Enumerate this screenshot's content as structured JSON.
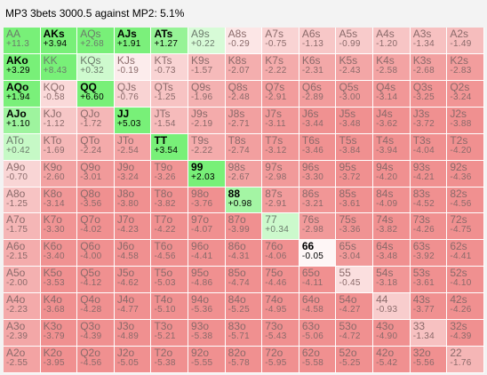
{
  "title": "MP3 3bets 3000.5 against MP2: 5.1%",
  "colors": {
    "strong_green": "#78f078",
    "neutral": "#ffffff",
    "strong_red": "#f09090"
  },
  "rows": [
    [
      {
        "hand": "AA",
        "val": "+11.3",
        "v": 11.3,
        "hl": false
      },
      {
        "hand": "AKs",
        "val": "+3.94",
        "v": 3.94,
        "hl": true
      },
      {
        "hand": "AQs",
        "val": "+2.68",
        "v": 2.68,
        "hl": false
      },
      {
        "hand": "AJs",
        "val": "+1.91",
        "v": 1.91,
        "hl": true
      },
      {
        "hand": "ATs",
        "val": "+1.27",
        "v": 1.27,
        "hl": true
      },
      {
        "hand": "A9s",
        "val": "+0.22",
        "v": 0.22,
        "hl": false
      },
      {
        "hand": "A8s",
        "val": "-0.29",
        "v": -0.29,
        "hl": false
      },
      {
        "hand": "A7s",
        "val": "-0.75",
        "v": -0.75,
        "hl": false
      },
      {
        "hand": "A6s",
        "val": "-1.13",
        "v": -1.13,
        "hl": false
      },
      {
        "hand": "A5s",
        "val": "-0.99",
        "v": -0.99,
        "hl": false
      },
      {
        "hand": "A4s",
        "val": "-1.20",
        "v": -1.2,
        "hl": false
      },
      {
        "hand": "A3s",
        "val": "-1.34",
        "v": -1.34,
        "hl": false
      },
      {
        "hand": "A2s",
        "val": "-1.49",
        "v": -1.49,
        "hl": false
      }
    ],
    [
      {
        "hand": "AKo",
        "val": "+3.29",
        "v": 3.29,
        "hl": true
      },
      {
        "hand": "KK",
        "val": "+8.43",
        "v": 8.43,
        "hl": false
      },
      {
        "hand": "KQs",
        "val": "+0.32",
        "v": 0.32,
        "hl": false
      },
      {
        "hand": "KJs",
        "val": "-0.19",
        "v": -0.19,
        "hl": false
      },
      {
        "hand": "KTs",
        "val": "-0.73",
        "v": -0.73,
        "hl": false
      },
      {
        "hand": "K9s",
        "val": "-1.57",
        "v": -1.57,
        "hl": false
      },
      {
        "hand": "K8s",
        "val": "-2.07",
        "v": -2.07,
        "hl": false
      },
      {
        "hand": "K7s",
        "val": "-2.22",
        "v": -2.22,
        "hl": false
      },
      {
        "hand": "K6s",
        "val": "-2.31",
        "v": -2.31,
        "hl": false
      },
      {
        "hand": "K5s",
        "val": "-2.43",
        "v": -2.43,
        "hl": false
      },
      {
        "hand": "K4s",
        "val": "-2.58",
        "v": -2.58,
        "hl": false
      },
      {
        "hand": "K3s",
        "val": "-2.68",
        "v": -2.68,
        "hl": false
      },
      {
        "hand": "K2s",
        "val": "-2.83",
        "v": -2.83,
        "hl": false
      }
    ],
    [
      {
        "hand": "AQo",
        "val": "+1.94",
        "v": 1.94,
        "hl": true
      },
      {
        "hand": "KQo",
        "val": "-0.58",
        "v": -0.58,
        "hl": false
      },
      {
        "hand": "QQ",
        "val": "+6.60",
        "v": 6.6,
        "hl": true
      },
      {
        "hand": "QJs",
        "val": "-0.76",
        "v": -0.76,
        "hl": false
      },
      {
        "hand": "QTs",
        "val": "-1.25",
        "v": -1.25,
        "hl": false
      },
      {
        "hand": "Q9s",
        "val": "-1.96",
        "v": -1.96,
        "hl": false
      },
      {
        "hand": "Q8s",
        "val": "-2.48",
        "v": -2.48,
        "hl": false
      },
      {
        "hand": "Q7s",
        "val": "-2.91",
        "v": -2.91,
        "hl": false
      },
      {
        "hand": "Q6s",
        "val": "-2.89",
        "v": -2.89,
        "hl": false
      },
      {
        "hand": "Q5s",
        "val": "-3.00",
        "v": -3.0,
        "hl": false
      },
      {
        "hand": "Q4s",
        "val": "-3.14",
        "v": -3.14,
        "hl": false
      },
      {
        "hand": "Q3s",
        "val": "-3.25",
        "v": -3.25,
        "hl": false
      },
      {
        "hand": "Q2s",
        "val": "-3.24",
        "v": -3.24,
        "hl": false
      }
    ],
    [
      {
        "hand": "AJo",
        "val": "+1.10",
        "v": 1.1,
        "hl": true
      },
      {
        "hand": "KJo",
        "val": "-1.12",
        "v": -1.12,
        "hl": false
      },
      {
        "hand": "QJo",
        "val": "-1.72",
        "v": -1.72,
        "hl": false
      },
      {
        "hand": "JJ",
        "val": "+5.03",
        "v": 5.03,
        "hl": true
      },
      {
        "hand": "JTs",
        "val": "-1.54",
        "v": -1.54,
        "hl": false
      },
      {
        "hand": "J9s",
        "val": "-2.19",
        "v": -2.19,
        "hl": false
      },
      {
        "hand": "J8s",
        "val": "-2.71",
        "v": -2.71,
        "hl": false
      },
      {
        "hand": "J7s",
        "val": "-3.11",
        "v": -3.11,
        "hl": false
      },
      {
        "hand": "J6s",
        "val": "-3.44",
        "v": -3.44,
        "hl": false
      },
      {
        "hand": "J5s",
        "val": "-3.48",
        "v": -3.48,
        "hl": false
      },
      {
        "hand": "J4s",
        "val": "-3.62",
        "v": -3.62,
        "hl": false
      },
      {
        "hand": "J3s",
        "val": "-3.72",
        "v": -3.72,
        "hl": false
      },
      {
        "hand": "J2s",
        "val": "-3.88",
        "v": -3.88,
        "hl": false
      }
    ],
    [
      {
        "hand": "ATo",
        "val": "+0.42",
        "v": 0.42,
        "hl": false
      },
      {
        "hand": "KTo",
        "val": "-1.69",
        "v": -1.69,
        "hl": false
      },
      {
        "hand": "QTo",
        "val": "-2.24",
        "v": -2.24,
        "hl": false
      },
      {
        "hand": "JTo",
        "val": "-2.54",
        "v": -2.54,
        "hl": false
      },
      {
        "hand": "TT",
        "val": "+3.54",
        "v": 3.54,
        "hl": true
      },
      {
        "hand": "T9s",
        "val": "-2.22",
        "v": -2.22,
        "hl": false
      },
      {
        "hand": "T8s",
        "val": "-2.74",
        "v": -2.74,
        "hl": false
      },
      {
        "hand": "T7s",
        "val": "-3.12",
        "v": -3.12,
        "hl": false
      },
      {
        "hand": "T6s",
        "val": "-3.46",
        "v": -3.46,
        "hl": false
      },
      {
        "hand": "T5s",
        "val": "-3.84",
        "v": -3.84,
        "hl": false
      },
      {
        "hand": "T4s",
        "val": "-3.94",
        "v": -3.94,
        "hl": false
      },
      {
        "hand": "T3s",
        "val": "-4.04",
        "v": -4.04,
        "hl": false
      },
      {
        "hand": "T2s",
        "val": "-4.20",
        "v": -4.2,
        "hl": false
      }
    ],
    [
      {
        "hand": "A9o",
        "val": "-0.70",
        "v": -0.7,
        "hl": false
      },
      {
        "hand": "K9o",
        "val": "-2.60",
        "v": -2.6,
        "hl": false
      },
      {
        "hand": "Q9o",
        "val": "-3.01",
        "v": -3.01,
        "hl": false
      },
      {
        "hand": "J9o",
        "val": "-3.24",
        "v": -3.24,
        "hl": false
      },
      {
        "hand": "T9o",
        "val": "-3.26",
        "v": -3.26,
        "hl": false
      },
      {
        "hand": "99",
        "val": "+2.03",
        "v": 2.03,
        "hl": true
      },
      {
        "hand": "98s",
        "val": "-2.67",
        "v": -2.67,
        "hl": false
      },
      {
        "hand": "97s",
        "val": "-2.98",
        "v": -2.98,
        "hl": false
      },
      {
        "hand": "96s",
        "val": "-3.30",
        "v": -3.3,
        "hl": false
      },
      {
        "hand": "95s",
        "val": "-3.72",
        "v": -3.72,
        "hl": false
      },
      {
        "hand": "94s",
        "val": "-4.20",
        "v": -4.2,
        "hl": false
      },
      {
        "hand": "93s",
        "val": "-4.21",
        "v": -4.21,
        "hl": false
      },
      {
        "hand": "92s",
        "val": "-4.36",
        "v": -4.36,
        "hl": false
      }
    ],
    [
      {
        "hand": "A8o",
        "val": "-1.25",
        "v": -1.25,
        "hl": false
      },
      {
        "hand": "K8o",
        "val": "-3.14",
        "v": -3.14,
        "hl": false
      },
      {
        "hand": "Q8o",
        "val": "-3.56",
        "v": -3.56,
        "hl": false
      },
      {
        "hand": "J8o",
        "val": "-3.80",
        "v": -3.8,
        "hl": false
      },
      {
        "hand": "T8o",
        "val": "-3.82",
        "v": -3.82,
        "hl": false
      },
      {
        "hand": "98o",
        "val": "-3.76",
        "v": -3.76,
        "hl": false
      },
      {
        "hand": "88",
        "val": "+0.98",
        "v": 0.98,
        "hl": true
      },
      {
        "hand": "87s",
        "val": "-2.91",
        "v": -2.91,
        "hl": false
      },
      {
        "hand": "86s",
        "val": "-3.21",
        "v": -3.21,
        "hl": false
      },
      {
        "hand": "85s",
        "val": "-3.61",
        "v": -3.61,
        "hl": false
      },
      {
        "hand": "84s",
        "val": "-4.09",
        "v": -4.09,
        "hl": false
      },
      {
        "hand": "83s",
        "val": "-4.52",
        "v": -4.52,
        "hl": false
      },
      {
        "hand": "82s",
        "val": "-4.56",
        "v": -4.56,
        "hl": false
      }
    ],
    [
      {
        "hand": "A7o",
        "val": "-1.75",
        "v": -1.75,
        "hl": false
      },
      {
        "hand": "K7o",
        "val": "-3.30",
        "v": -3.3,
        "hl": false
      },
      {
        "hand": "Q7o",
        "val": "-4.02",
        "v": -4.02,
        "hl": false
      },
      {
        "hand": "J7o",
        "val": "-4.23",
        "v": -4.23,
        "hl": false
      },
      {
        "hand": "T7o",
        "val": "-4.22",
        "v": -4.22,
        "hl": false
      },
      {
        "hand": "97o",
        "val": "-4.07",
        "v": -4.07,
        "hl": false
      },
      {
        "hand": "87o",
        "val": "-3.99",
        "v": -3.99,
        "hl": false
      },
      {
        "hand": "77",
        "val": "+0.34",
        "v": 0.34,
        "hl": false
      },
      {
        "hand": "76s",
        "val": "-2.98",
        "v": -2.98,
        "hl": false
      },
      {
        "hand": "75s",
        "val": "-3.36",
        "v": -3.36,
        "hl": false
      },
      {
        "hand": "74s",
        "val": "-3.82",
        "v": -3.82,
        "hl": false
      },
      {
        "hand": "73s",
        "val": "-4.26",
        "v": -4.26,
        "hl": false
      },
      {
        "hand": "72s",
        "val": "-4.75",
        "v": -4.75,
        "hl": false
      }
    ],
    [
      {
        "hand": "A6o",
        "val": "-2.15",
        "v": -2.15,
        "hl": false
      },
      {
        "hand": "K6o",
        "val": "-3.40",
        "v": -3.4,
        "hl": false
      },
      {
        "hand": "Q6o",
        "val": "-4.00",
        "v": -4.0,
        "hl": false
      },
      {
        "hand": "J6o",
        "val": "-4.58",
        "v": -4.58,
        "hl": false
      },
      {
        "hand": "T6o",
        "val": "-4.56",
        "v": -4.56,
        "hl": false
      },
      {
        "hand": "96o",
        "val": "-4.41",
        "v": -4.41,
        "hl": false
      },
      {
        "hand": "86o",
        "val": "-4.31",
        "v": -4.31,
        "hl": false
      },
      {
        "hand": "76o",
        "val": "-4.06",
        "v": -4.06,
        "hl": false
      },
      {
        "hand": "66",
        "val": "-0.05",
        "v": -0.05,
        "hl": true
      },
      {
        "hand": "65s",
        "val": "-3.04",
        "v": -3.04,
        "hl": false
      },
      {
        "hand": "64s",
        "val": "-3.48",
        "v": -3.48,
        "hl": false
      },
      {
        "hand": "63s",
        "val": "-3.92",
        "v": -3.92,
        "hl": false
      },
      {
        "hand": "62s",
        "val": "-4.41",
        "v": -4.41,
        "hl": false
      }
    ],
    [
      {
        "hand": "A5o",
        "val": "-2.00",
        "v": -2.0,
        "hl": false
      },
      {
        "hand": "K5o",
        "val": "-3.53",
        "v": -3.53,
        "hl": false
      },
      {
        "hand": "Q5o",
        "val": "-4.12",
        "v": -4.12,
        "hl": false
      },
      {
        "hand": "J5o",
        "val": "-4.62",
        "v": -4.62,
        "hl": false
      },
      {
        "hand": "T5o",
        "val": "-5.03",
        "v": -5.03,
        "hl": false
      },
      {
        "hand": "95o",
        "val": "-4.86",
        "v": -4.86,
        "hl": false
      },
      {
        "hand": "85o",
        "val": "-4.74",
        "v": -4.74,
        "hl": false
      },
      {
        "hand": "75o",
        "val": "-4.46",
        "v": -4.46,
        "hl": false
      },
      {
        "hand": "65o",
        "val": "-4.11",
        "v": -4.11,
        "hl": false
      },
      {
        "hand": "55",
        "val": "-0.45",
        "v": -0.45,
        "hl": false
      },
      {
        "hand": "54s",
        "val": "-3.18",
        "v": -3.18,
        "hl": false
      },
      {
        "hand": "53s",
        "val": "-3.61",
        "v": -3.61,
        "hl": false
      },
      {
        "hand": "52s",
        "val": "-4.10",
        "v": -4.1,
        "hl": false
      }
    ],
    [
      {
        "hand": "A4o",
        "val": "-2.23",
        "v": -2.23,
        "hl": false
      },
      {
        "hand": "K4o",
        "val": "-3.68",
        "v": -3.68,
        "hl": false
      },
      {
        "hand": "Q4o",
        "val": "-4.28",
        "v": -4.28,
        "hl": false
      },
      {
        "hand": "J4o",
        "val": "-4.77",
        "v": -4.77,
        "hl": false
      },
      {
        "hand": "T4o",
        "val": "-5.10",
        "v": -5.1,
        "hl": false
      },
      {
        "hand": "94o",
        "val": "-5.36",
        "v": -5.36,
        "hl": false
      },
      {
        "hand": "84o",
        "val": "-5.25",
        "v": -5.25,
        "hl": false
      },
      {
        "hand": "74o",
        "val": "-4.95",
        "v": -4.95,
        "hl": false
      },
      {
        "hand": "64o",
        "val": "-4.58",
        "v": -4.58,
        "hl": false
      },
      {
        "hand": "54o",
        "val": "-4.27",
        "v": -4.27,
        "hl": false
      },
      {
        "hand": "44",
        "val": "-0.93",
        "v": -0.93,
        "hl": false
      },
      {
        "hand": "43s",
        "val": "-3.77",
        "v": -3.77,
        "hl": false
      },
      {
        "hand": "42s",
        "val": "-4.26",
        "v": -4.26,
        "hl": false
      }
    ],
    [
      {
        "hand": "A3o",
        "val": "-2.39",
        "v": -2.39,
        "hl": false
      },
      {
        "hand": "K3o",
        "val": "-3.79",
        "v": -3.79,
        "hl": false
      },
      {
        "hand": "Q3o",
        "val": "-4.39",
        "v": -4.39,
        "hl": false
      },
      {
        "hand": "J3o",
        "val": "-4.89",
        "v": -4.89,
        "hl": false
      },
      {
        "hand": "T3o",
        "val": "-5.21",
        "v": -5.21,
        "hl": false
      },
      {
        "hand": "93o",
        "val": "-5.38",
        "v": -5.38,
        "hl": false
      },
      {
        "hand": "83o",
        "val": "-5.71",
        "v": -5.71,
        "hl": false
      },
      {
        "hand": "73o",
        "val": "-5.43",
        "v": -5.43,
        "hl": false
      },
      {
        "hand": "63o",
        "val": "-5.06",
        "v": -5.06,
        "hl": false
      },
      {
        "hand": "53o",
        "val": "-4.72",
        "v": -4.72,
        "hl": false
      },
      {
        "hand": "43o",
        "val": "-4.90",
        "v": -4.9,
        "hl": false
      },
      {
        "hand": "33",
        "val": "-1.34",
        "v": -1.34,
        "hl": false
      },
      {
        "hand": "32s",
        "val": "-4.39",
        "v": -4.39,
        "hl": false
      }
    ],
    [
      {
        "hand": "A2o",
        "val": "-2.55",
        "v": -2.55,
        "hl": false
      },
      {
        "hand": "K2o",
        "val": "-3.95",
        "v": -3.95,
        "hl": false
      },
      {
        "hand": "Q2o",
        "val": "-4.56",
        "v": -4.56,
        "hl": false
      },
      {
        "hand": "J2o",
        "val": "-5.05",
        "v": -5.05,
        "hl": false
      },
      {
        "hand": "T2o",
        "val": "-5.38",
        "v": -5.38,
        "hl": false
      },
      {
        "hand": "92o",
        "val": "-5.55",
        "v": -5.55,
        "hl": false
      },
      {
        "hand": "82o",
        "val": "-5.78",
        "v": -5.78,
        "hl": false
      },
      {
        "hand": "72o",
        "val": "-5.95",
        "v": -5.95,
        "hl": false
      },
      {
        "hand": "62o",
        "val": "-5.58",
        "v": -5.58,
        "hl": false
      },
      {
        "hand": "52o",
        "val": "-5.25",
        "v": -5.25,
        "hl": false
      },
      {
        "hand": "42o",
        "val": "-5.42",
        "v": -5.42,
        "hl": false
      },
      {
        "hand": "32o",
        "val": "-5.56",
        "v": -5.56,
        "hl": false
      },
      {
        "hand": "22",
        "val": "-1.76",
        "v": -1.76,
        "hl": false
      }
    ]
  ]
}
